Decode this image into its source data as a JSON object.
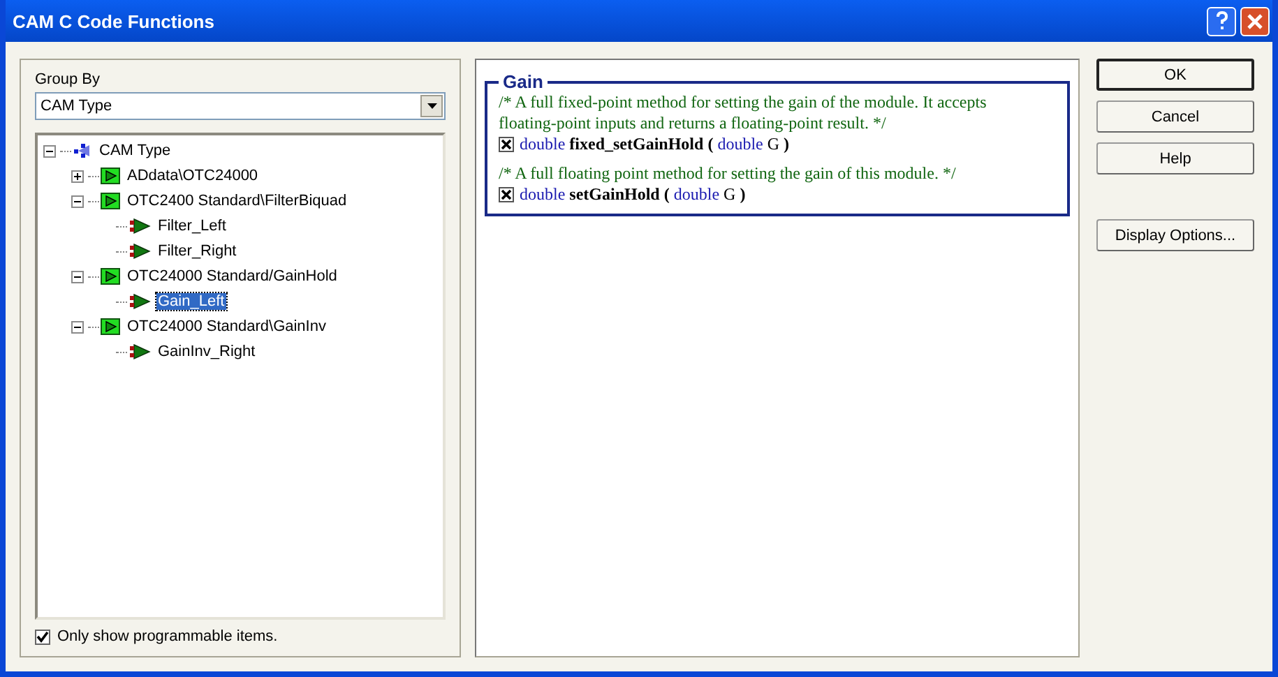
{
  "window": {
    "title": "CAM C Code Functions"
  },
  "group_by": {
    "label": "Group By",
    "value": "CAM Type"
  },
  "tree": [
    {
      "label": "CAM Type",
      "expanded": true,
      "selected": false,
      "children": [
        {
          "label": "ADdata\\OTC24000",
          "expanded": false,
          "selected": false
        },
        {
          "label": "OTC2400 Standard\\FilterBiquad",
          "expanded": true,
          "selected": false,
          "children": [
            {
              "label": "Filter_Left",
              "selected": false
            },
            {
              "label": "Filter_Right",
              "selected": false
            }
          ]
        },
        {
          "label": "OTC24000 Standard/GainHold",
          "expanded": true,
          "selected": false,
          "children": [
            {
              "label": "Gain_Left",
              "selected": true
            }
          ]
        },
        {
          "label": "OTC24000 Standard\\GainInv",
          "expanded": true,
          "selected": false,
          "children": [
            {
              "label": "GainInv_Right",
              "selected": false
            }
          ]
        }
      ]
    }
  ],
  "only_programmable": {
    "label": "Only show programmable items.",
    "checked": true
  },
  "group": {
    "title": "Gain",
    "functions": [
      {
        "comment": "/* A full fixed-point method for setting the gain of the module. It accepts\nfloating-point inputs and returns a floating-point result.  */",
        "checked": true,
        "return_type": "double",
        "name": "fixed_setGainHold",
        "open": "(",
        "param_type": "double",
        "param": "G",
        "close": ")"
      },
      {
        "comment": "/* A full floating point method for setting the gain of this module.  */",
        "checked": true,
        "return_type": "double",
        "name": "setGainHold",
        "open": "(",
        "param_type": "double",
        "param": "G",
        "close": ")"
      }
    ]
  },
  "buttons": [
    {
      "label": "OK",
      "default": true
    },
    {
      "label": "Cancel",
      "default": false
    },
    {
      "label": "Help",
      "default": false
    },
    {
      "label": "Display Options...",
      "default": false
    }
  ]
}
